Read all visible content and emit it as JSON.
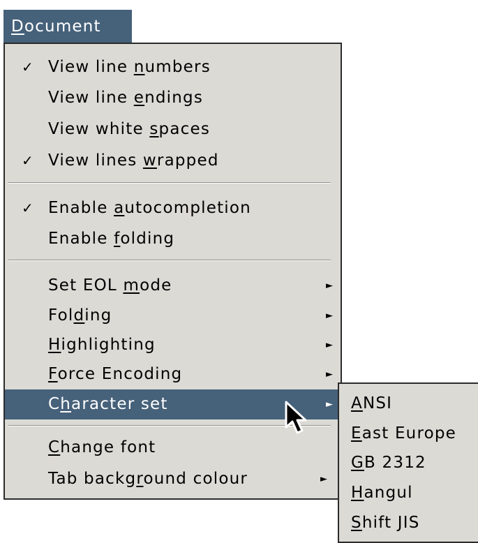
{
  "menubar": {
    "title_underlined": "D",
    "title_rest": "ocument"
  },
  "menu": {
    "items": [
      {
        "checked": true,
        "check_glyph": "✓",
        "pre": "View line ",
        "u": "n",
        "post": "umbers"
      },
      {
        "checked": false,
        "pre": "View line ",
        "u": "e",
        "post": "ndings"
      },
      {
        "checked": false,
        "pre": "View white ",
        "u": "s",
        "post": "paces"
      },
      {
        "checked": true,
        "check_glyph": "✓",
        "pre": "View lines ",
        "u": "w",
        "post": "rapped"
      },
      {
        "checked": true,
        "check_glyph": "✓",
        "pre": "Enable ",
        "u": "a",
        "post": "utocompletion"
      },
      {
        "checked": false,
        "pre": "Enable ",
        "u": "f",
        "post": "olding"
      },
      {
        "submenu": true,
        "arrow_glyph": "►",
        "pre": "Set EOL ",
        "u": "m",
        "post": "ode"
      },
      {
        "submenu": true,
        "arrow_glyph": "►",
        "pre": "Fol",
        "u": "d",
        "post": "ing"
      },
      {
        "submenu": true,
        "arrow_glyph": "►",
        "pre": "",
        "u": "H",
        "post": "ighlighting"
      },
      {
        "submenu": true,
        "arrow_glyph": "►",
        "pre": "",
        "u": "F",
        "post": "orce Encoding"
      },
      {
        "submenu": true,
        "highlighted": true,
        "arrow_glyph": "►",
        "pre": "C",
        "u": "h",
        "post": "aracter set"
      },
      {
        "pre": "",
        "u": "C",
        "post": "hange font"
      },
      {
        "submenu": true,
        "arrow_glyph": "►",
        "pre": "Tab backg",
        "u": "r",
        "post": "ound colour"
      }
    ]
  },
  "submenu": {
    "items": [
      {
        "u": "A",
        "post": "NSI"
      },
      {
        "u": "E",
        "post": "ast Europe"
      },
      {
        "u": "G",
        "post": "B 2312"
      },
      {
        "u": "H",
        "post": "angul"
      },
      {
        "u": "S",
        "post": "hift JIS"
      }
    ]
  },
  "colors": {
    "highlight": "#46617a",
    "menu_background": "#dcdad5",
    "border": "#2b2b2b"
  },
  "icons": {
    "check": "check-icon",
    "submenu_arrow": "submenu-arrow-icon",
    "cursor": "mouse-pointer-icon"
  }
}
